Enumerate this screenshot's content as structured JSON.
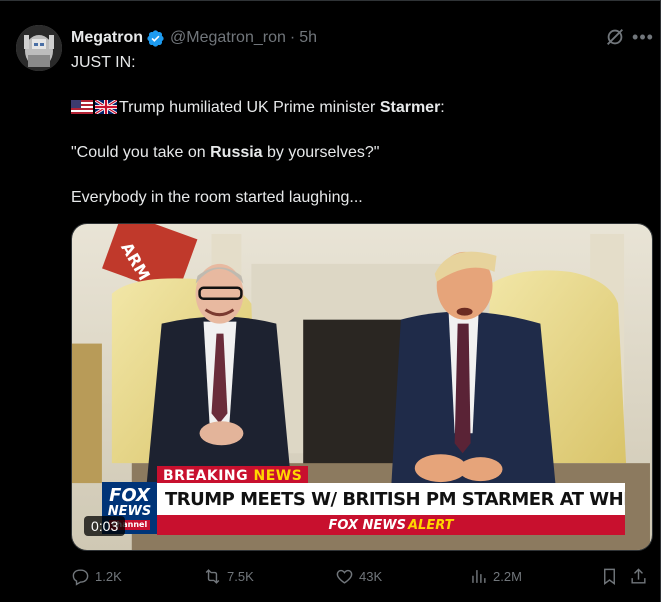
{
  "author": {
    "display_name": "Megatron",
    "handle": "@Megatron_ron",
    "separator": "·",
    "time": "5h"
  },
  "tweet": {
    "line1": "JUST IN:",
    "line2_prefix": "Trump humiliated UK Prime minister ",
    "line2_bold": "Starmer",
    "line2_suffix": ":",
    "line3_prefix": "\"Could you take on ",
    "line3_bold": "Russia",
    "line3_suffix": " by yourselves?\"",
    "line4": "Everybody in the room started laughing..."
  },
  "media": {
    "video_time": "0:03",
    "breaking_label": "BREAKING",
    "breaking_news": "NEWS",
    "chyron": "TRUMP MEETS W/ BRITISH PM STARMER AT WHITE HOUSE",
    "alert_brand": "FOX NEWS",
    "alert_word": "ALERT",
    "logo_fox": "FOX",
    "logo_news": "NEWS",
    "logo_channel": "channel",
    "banner_text": "ARM"
  },
  "actions": {
    "replies": "1.2K",
    "reposts": "7.5K",
    "likes": "43K",
    "views": "2.2M"
  },
  "icons": {
    "verified": "verified-badge-icon",
    "grok": "grok-icon",
    "more": "more-icon",
    "reply": "reply-icon",
    "repost": "repost-icon",
    "like": "heart-icon",
    "views": "views-icon",
    "bookmark": "bookmark-icon",
    "share": "share-icon"
  },
  "colors": {
    "background": "#000000",
    "text": "#e7e9ea",
    "muted": "#71767b",
    "verified": "#1d9bf0",
    "fox_red": "#c8102e",
    "fox_blue": "#003478"
  }
}
